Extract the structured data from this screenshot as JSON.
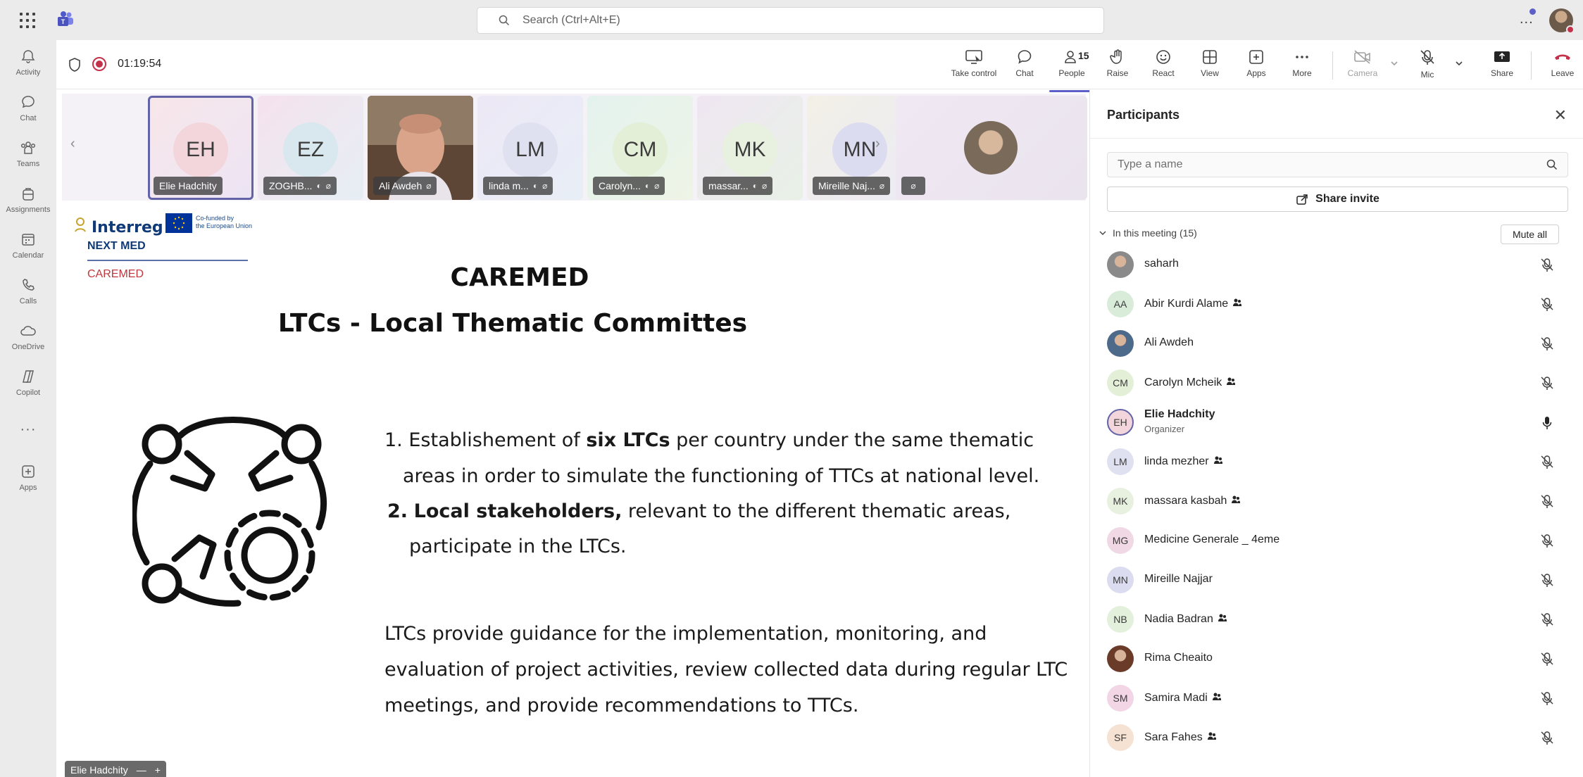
{
  "topbar": {
    "search_placeholder": "Search (Ctrl+Alt+E)",
    "more": "..."
  },
  "rail": [
    {
      "label": "Activity",
      "icon": "bell-icon"
    },
    {
      "label": "Chat",
      "icon": "chat-icon"
    },
    {
      "label": "Teams",
      "icon": "teams-icon"
    },
    {
      "label": "Assignments",
      "icon": "backpack-icon"
    },
    {
      "label": "Calendar",
      "icon": "calendar-icon"
    },
    {
      "label": "Calls",
      "icon": "phone-icon"
    },
    {
      "label": "OneDrive",
      "icon": "cloud-icon"
    },
    {
      "label": "Copilot",
      "icon": "copilot-icon"
    },
    {
      "label": "",
      "icon": "more-icon"
    },
    {
      "label": "Apps",
      "icon": "add-apps-icon"
    }
  ],
  "meeting": {
    "timer": "01:19:54",
    "controls": {
      "take_control": "Take control",
      "chat": "Chat",
      "people": "People",
      "people_count": "15",
      "raise": "Raise",
      "react": "React",
      "view": "View",
      "apps": "Apps",
      "more": "More",
      "camera": "Camera",
      "mic": "Mic",
      "share": "Share",
      "leave": "Leave"
    }
  },
  "strip": {
    "tiles": [
      {
        "initials": "EH",
        "name": "Elie Hadchity",
        "bg": "#f3d6dc"
      },
      {
        "initials": "EZ",
        "name": "ZOGHB...",
        "bg": "#d8e8ee"
      },
      {
        "initials": "",
        "name": "Ali Awdeh",
        "bg": "#7a5a4a"
      },
      {
        "initials": "LM",
        "name": "linda m...",
        "bg": "#dfe0f0"
      },
      {
        "initials": "CM",
        "name": "Carolyn...",
        "bg": "#e4efd8"
      },
      {
        "initials": "MK",
        "name": "massar...",
        "bg": "#e8f1df"
      },
      {
        "initials": "MN",
        "name": "Mireille Naj...",
        "bg": "#dcdcf0"
      }
    ]
  },
  "slide": {
    "logo_interreg": "Interreg",
    "logo_eu": "Co-funded by\nthe European Union",
    "logo_nextmed": "NEXT MED",
    "logo_caremed": "CAREMED",
    "title": "CAREMED",
    "subtitle": "LTCs - Local Thematic Committes",
    "item1_num": "1.",
    "item1_pre": "Establishement of ",
    "item1_bold": "six LTCs",
    "item1_post": " per country under the same thematic",
    "item1_line2": "areas in order to simulate the functioning of TTCs at national level.",
    "item2_num": "2.",
    "item2_bold": "Local stakeholders,",
    "item2_post": " relevant to the different thematic areas,",
    "item2_line2": "participate in the LTCs.",
    "para_line1": "LTCs provide guidance for the implementation, monitoring, and",
    "para_line2": "evaluation of project activities, review collected data during regular LTC",
    "para_line3": "meetings, and provide recommendations to TTCs.",
    "presenter": "Elie Hadchity"
  },
  "participants": {
    "title": "Participants",
    "search_placeholder": "Type a name",
    "share_invite": "Share invite",
    "section_label": "In this meeting (15)",
    "mute_all": "Mute all",
    "people": [
      {
        "name": "saharh",
        "initials": "",
        "bg": "#8a8a8a",
        "photo": true,
        "tag": false,
        "role": "",
        "mic": "muted"
      },
      {
        "name": "Abir Kurdi Alame",
        "initials": "AA",
        "bg": "#d8ecd9",
        "tag": true,
        "role": "",
        "mic": "muted"
      },
      {
        "name": "Ali Awdeh",
        "initials": "",
        "bg": "#4d6a8a",
        "photo": true,
        "tag": false,
        "role": "",
        "mic": "muted"
      },
      {
        "name": "Carolyn Mcheik",
        "initials": "CM",
        "bg": "#e4efd8",
        "tag": true,
        "role": "",
        "mic": "muted"
      },
      {
        "name": "Elie Hadchity",
        "initials": "EH",
        "bg": "#f3d6dc",
        "tag": false,
        "role": "Organizer",
        "mic": "on"
      },
      {
        "name": "linda mezher",
        "initials": "LM",
        "bg": "#dfe0f0",
        "tag": true,
        "role": "",
        "mic": "muted"
      },
      {
        "name": "massara kasbah",
        "initials": "MK",
        "bg": "#e8f1df",
        "tag": true,
        "role": "",
        "mic": "muted"
      },
      {
        "name": "Medicine Generale _ 4eme",
        "initials": "MG",
        "bg": "#f0d8e4",
        "tag": false,
        "role": "",
        "mic": "muted"
      },
      {
        "name": "Mireille Najjar",
        "initials": "MN",
        "bg": "#dcdcf0",
        "tag": false,
        "role": "",
        "mic": "muted"
      },
      {
        "name": "Nadia Badran",
        "initials": "NB",
        "bg": "#e2f0dc",
        "tag": true,
        "role": "",
        "mic": "muted"
      },
      {
        "name": "Rima Cheaito",
        "initials": "",
        "bg": "#6b3b2a",
        "photo": true,
        "tag": false,
        "role": "",
        "mic": "muted"
      },
      {
        "name": "Samira Madi",
        "initials": "SM",
        "bg": "#f2d6e6",
        "tag": true,
        "role": "",
        "mic": "muted"
      },
      {
        "name": "Sara Fahes",
        "initials": "SF",
        "bg": "#f6e2d2",
        "tag": true,
        "role": "",
        "mic": "muted"
      }
    ]
  }
}
